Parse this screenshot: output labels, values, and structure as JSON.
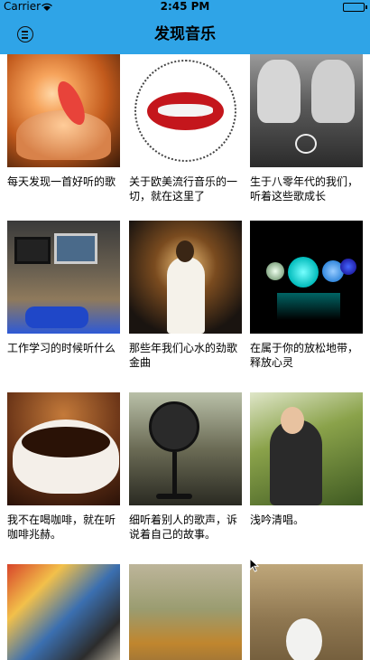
{
  "status_bar": {
    "carrier": "Carrier",
    "time": "2:45 PM"
  },
  "nav": {
    "title": "发现音乐",
    "menu_icon": "menu-circle-icon"
  },
  "playlists": [
    {
      "title": "每天发现一首好听的歌",
      "image": "hands-holding-feather"
    },
    {
      "title": "关于欧美流行音乐的一切，就在这里了",
      "image": "red-lips-text-circle"
    },
    {
      "title": "生于八零年代的我们，听着这些歌成长",
      "image": "sneakers-heart-laces"
    },
    {
      "title": "工作学习的时候听什么",
      "image": "computer-desk"
    },
    {
      "title": "那些年我们心水的劲歌金曲",
      "image": "singer-on-stage"
    },
    {
      "title": "在属于你的放松地带，释放心灵",
      "image": "glowing-bokeh-lights"
    },
    {
      "title": "我不在喝咖啡，就在听咖啡兆赫。",
      "image": "coffee-cup"
    },
    {
      "title": "细听着别人的歌声，诉说着自己的故事。",
      "image": "vintage-microphone"
    },
    {
      "title": "浅吟清唱。",
      "image": "woman-reading-book"
    },
    {
      "title": "",
      "image": "cubist-painting"
    },
    {
      "title": "",
      "image": "autumn-foliage"
    },
    {
      "title": "",
      "image": "white-feather-on-grass"
    }
  ]
}
